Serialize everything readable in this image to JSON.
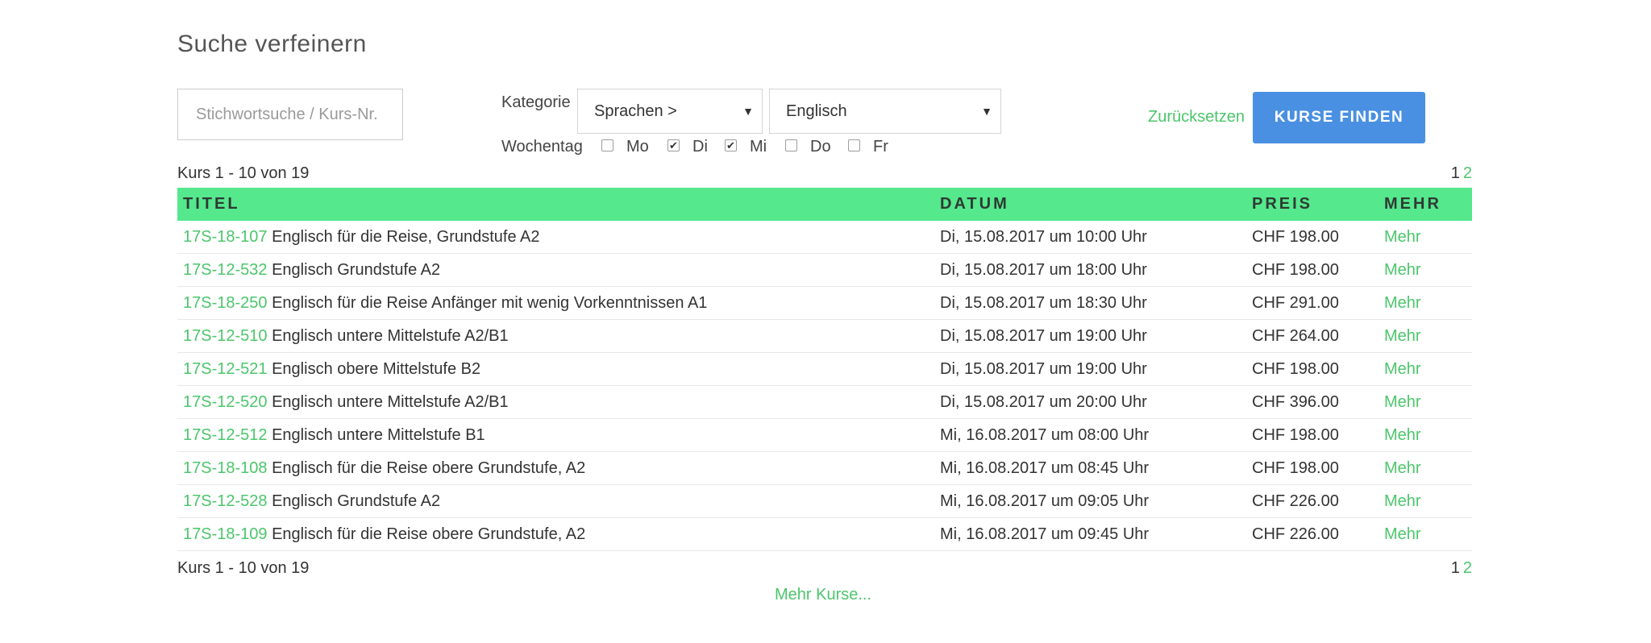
{
  "heading": "Suche verfeinern",
  "search": {
    "placeholder": "Stichwortsuche / Kurs-Nr.",
    "value": ""
  },
  "filters": {
    "category_label": "Kategorie",
    "category_value": "Sprachen >",
    "subcategory_value": "Englisch",
    "weekday_label": "Wochentag",
    "weekdays": [
      {
        "label": "Mo",
        "checked": false
      },
      {
        "label": "Di",
        "checked": true
      },
      {
        "label": "Mi",
        "checked": true
      },
      {
        "label": "Do",
        "checked": false
      },
      {
        "label": "Fr",
        "checked": false
      }
    ]
  },
  "actions": {
    "reset_label": "Zurücksetzen",
    "find_label": "KURSE FINDEN"
  },
  "summary": {
    "range_text": "Kurs 1 - 10 von 19",
    "pages": [
      "1",
      "2"
    ]
  },
  "table": {
    "headers": {
      "title": "TITEL",
      "date": "DATUM",
      "price": "PREIS",
      "more": "MEHR"
    },
    "rows": [
      {
        "code": "17S-18-107",
        "title": "Englisch für die Reise, Grundstufe A2",
        "date": "Di, 15.08.2017 um 10:00 Uhr",
        "price": "CHF 198.00",
        "more": "Mehr"
      },
      {
        "code": "17S-12-532",
        "title": "Englisch Grundstufe A2",
        "date": "Di, 15.08.2017 um 18:00 Uhr",
        "price": "CHF 198.00",
        "more": "Mehr"
      },
      {
        "code": "17S-18-250",
        "title": "Englisch für die Reise Anfänger mit wenig Vorkenntnissen A1",
        "date": "Di, 15.08.2017 um 18:30 Uhr",
        "price": "CHF 291.00",
        "more": "Mehr"
      },
      {
        "code": "17S-12-510",
        "title": "Englisch untere Mittelstufe A2/B1",
        "date": "Di, 15.08.2017 um 19:00 Uhr",
        "price": "CHF 264.00",
        "more": "Mehr"
      },
      {
        "code": "17S-12-521",
        "title": "Englisch obere Mittelstufe B2",
        "date": "Di, 15.08.2017 um 19:00 Uhr",
        "price": "CHF 198.00",
        "more": "Mehr"
      },
      {
        "code": "17S-12-520",
        "title": "Englisch untere Mittelstufe A2/B1",
        "date": "Di, 15.08.2017 um 20:00 Uhr",
        "price": "CHF 396.00",
        "more": "Mehr"
      },
      {
        "code": "17S-12-512",
        "title": "Englisch untere Mittelstufe B1",
        "date": "Mi, 16.08.2017 um 08:00 Uhr",
        "price": "CHF 198.00",
        "more": "Mehr"
      },
      {
        "code": "17S-18-108",
        "title": "Englisch für die Reise obere Grundstufe, A2",
        "date": "Mi, 16.08.2017 um 08:45 Uhr",
        "price": "CHF 198.00",
        "more": "Mehr"
      },
      {
        "code": "17S-12-528",
        "title": "Englisch Grundstufe A2",
        "date": "Mi, 16.08.2017 um 09:05 Uhr",
        "price": "CHF 226.00",
        "more": "Mehr"
      },
      {
        "code": "17S-18-109",
        "title": "Englisch für die Reise obere Grundstufe, A2",
        "date": "Mi, 16.08.2017 um 09:45 Uhr",
        "price": "CHF 226.00",
        "more": "Mehr"
      }
    ]
  },
  "more_courses_label": "Mehr Kurse...",
  "colors": {
    "accent_green": "#4cc66b",
    "header_green": "#55e88d",
    "button_blue": "#4a90e2"
  }
}
